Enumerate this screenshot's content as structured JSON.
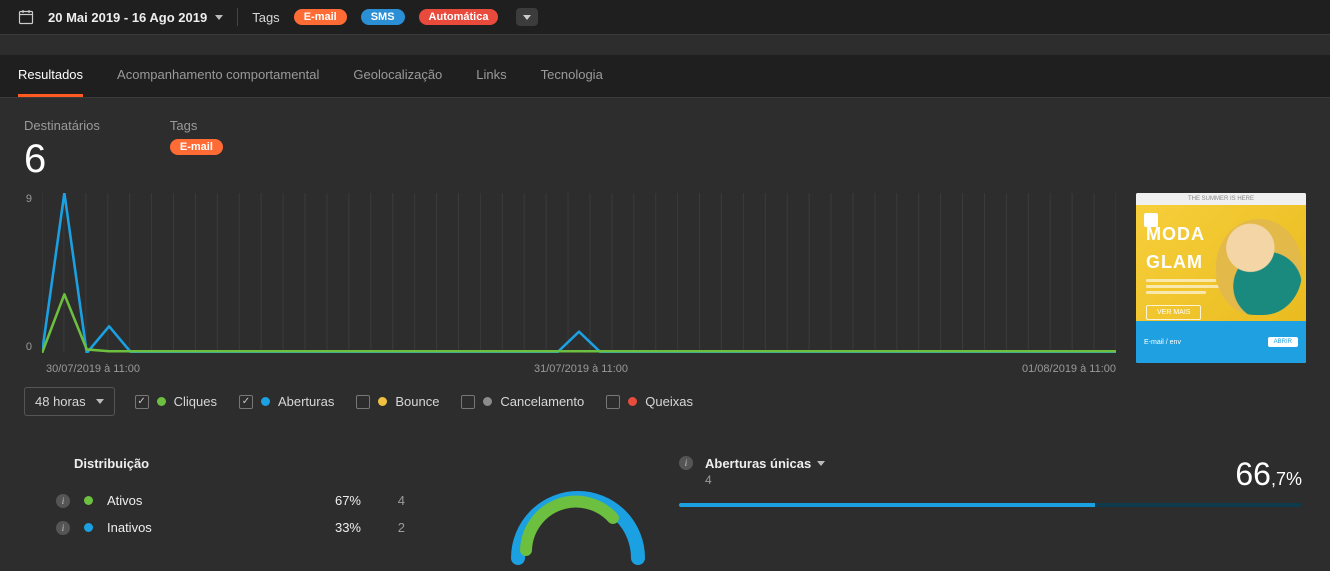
{
  "topbar": {
    "date_range": "20 Mai 2019 - 16 Ago 2019",
    "tags_label": "Tags",
    "tags": {
      "email": "E-mail",
      "sms": "SMS",
      "auto": "Automática"
    }
  },
  "tabs": [
    "Resultados",
    "Acompanhamento comportamental",
    "Geolocalização",
    "Links",
    "Tecnologia"
  ],
  "active_tab_index": 0,
  "summary": {
    "recipients_label": "Destinatários",
    "recipients_value": "6",
    "tags_label": "Tags",
    "tag_email": "E-mail"
  },
  "chart_data": {
    "type": "line",
    "x_ticks": [
      "30/07/2019 à 11:00",
      "31/07/2019 à 11:00",
      "01/08/2019 à 11:00"
    ],
    "ylim": [
      0,
      9
    ],
    "y_ticks": [
      9,
      0
    ],
    "series": [
      {
        "name": "Aberturas",
        "color": "#1ba0e2",
        "values": [
          0,
          9,
          0,
          1.5,
          0,
          0,
          0,
          0,
          0,
          0,
          0,
          0,
          0,
          0,
          0,
          0,
          0,
          0,
          0,
          0,
          0,
          0,
          0,
          0,
          1.2,
          0,
          0,
          0,
          0,
          0,
          0,
          0,
          0,
          0,
          0,
          0,
          0,
          0,
          0,
          0,
          0,
          0,
          0,
          0,
          0,
          0,
          0,
          0,
          0
        ]
      },
      {
        "name": "Cliques",
        "color": "#6cbf3f",
        "values": [
          0,
          3.3,
          0.2,
          0.1,
          0.1,
          0.1,
          0.1,
          0.1,
          0.1,
          0.1,
          0.1,
          0.1,
          0.1,
          0.1,
          0.1,
          0.1,
          0.1,
          0.1,
          0.1,
          0.1,
          0.1,
          0.1,
          0.1,
          0.1,
          0.1,
          0.1,
          0.1,
          0.1,
          0.1,
          0.1,
          0.1,
          0.1,
          0.1,
          0.1,
          0.1,
          0.1,
          0.1,
          0.1,
          0.1,
          0.1,
          0.1,
          0.1,
          0.1,
          0.1,
          0.1,
          0.1,
          0.1,
          0.1,
          0.1
        ]
      }
    ],
    "grid_count": 50
  },
  "chart_controls": {
    "range": "48 horas",
    "items": [
      {
        "key": "cliques",
        "label": "Cliques",
        "color": "green",
        "checked": true
      },
      {
        "key": "aberturas",
        "label": "Aberturas",
        "color": "blue",
        "checked": true
      },
      {
        "key": "bounce",
        "label": "Bounce",
        "color": "yellow",
        "checked": false
      },
      {
        "key": "cancel",
        "label": "Cancelamento",
        "color": "grey",
        "checked": false
      },
      {
        "key": "queixas",
        "label": "Queixas",
        "color": "red",
        "checked": false
      }
    ]
  },
  "distribution": {
    "title": "Distribuição",
    "rows": [
      {
        "label": "Ativos",
        "pct": "67%",
        "count": "4",
        "color": "green"
      },
      {
        "label": "Inativos",
        "pct": "33%",
        "count": "2",
        "color": "blue"
      }
    ]
  },
  "right_panel": {
    "title": "Aberturas únicas",
    "count": "4",
    "big_int": "66",
    "big_dec": ",7%",
    "bar_pct": 66.7
  },
  "thumb": {
    "strapline": "THE SUMMER IS HERE",
    "headline1": "MODA",
    "headline2": "GLAM",
    "cta": "VER MAIS",
    "footer": "E-mail / env",
    "footer_btn": "ABRIR"
  }
}
